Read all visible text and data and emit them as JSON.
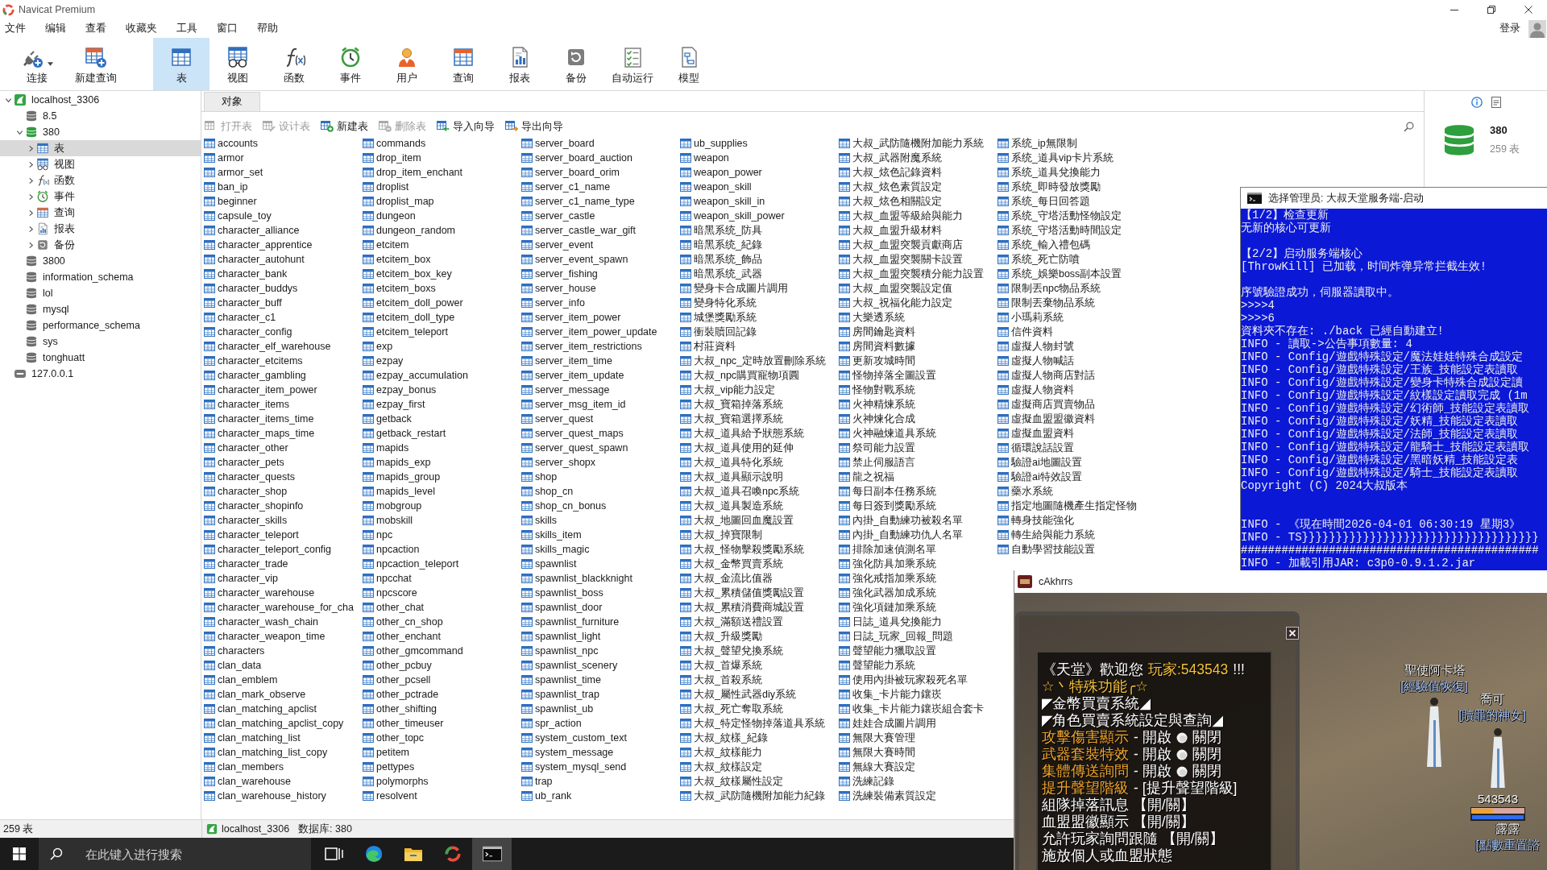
{
  "window": {
    "title": "Navicat Premium"
  },
  "menu_bar": {
    "items": [
      "文件",
      "编辑",
      "查看",
      "收藏夹",
      "工具",
      "窗口",
      "帮助"
    ],
    "login": "登录"
  },
  "toolbar": {
    "main": [
      {
        "label": "连接",
        "kind": "connection",
        "selected": false,
        "dropdown": true
      },
      {
        "label": "新建查询",
        "kind": "new_query",
        "selected": false,
        "dropdown": false
      }
    ],
    "objects": [
      {
        "label": "表",
        "kind": "table",
        "selected": true
      },
      {
        "label": "视图",
        "kind": "view",
        "selected": false
      },
      {
        "label": "函数",
        "kind": "function",
        "selected": false
      },
      {
        "label": "事件",
        "kind": "event",
        "selected": false
      },
      {
        "label": "用户",
        "kind": "user",
        "selected": false
      },
      {
        "label": "查询",
        "kind": "query",
        "selected": false
      },
      {
        "label": "报表",
        "kind": "report",
        "selected": false
      },
      {
        "label": "备份",
        "kind": "backup",
        "selected": false
      },
      {
        "label": "自动运行",
        "kind": "automation",
        "selected": false
      },
      {
        "label": "模型",
        "kind": "model",
        "selected": false
      }
    ]
  },
  "sidebar": {
    "tree": [
      {
        "label": "localhost_3306",
        "kind": "connection",
        "expanded": true,
        "selected": false,
        "children": [
          {
            "label": "8.5",
            "kind": "database",
            "expanded": false,
            "selected": false
          },
          {
            "label": "380",
            "kind": "database",
            "expanded": true,
            "selected": false,
            "children": [
              {
                "label": "表",
                "kind": "tables",
                "expanded": false,
                "selected": true
              },
              {
                "label": "视图",
                "kind": "views",
                "expanded": false,
                "selected": false
              },
              {
                "label": "函数",
                "kind": "functions",
                "expanded": false,
                "selected": false
              },
              {
                "label": "事件",
                "kind": "events",
                "expanded": false,
                "selected": false
              },
              {
                "label": "查询",
                "kind": "queries",
                "expanded": false,
                "selected": false
              },
              {
                "label": "报表",
                "kind": "reports",
                "expanded": false,
                "selected": false
              },
              {
                "label": "备份",
                "kind": "backups",
                "expanded": false,
                "selected": false
              }
            ]
          },
          {
            "label": "3800",
            "kind": "database",
            "expanded": false,
            "selected": false
          },
          {
            "label": "information_schema",
            "kind": "database",
            "expanded": false,
            "selected": false
          },
          {
            "label": "lol",
            "kind": "database",
            "expanded": false,
            "selected": false
          },
          {
            "label": "mysql",
            "kind": "database",
            "expanded": false,
            "selected": false
          },
          {
            "label": "performance_schema",
            "kind": "database",
            "expanded": false,
            "selected": false
          },
          {
            "label": "sys",
            "kind": "database",
            "expanded": false,
            "selected": false
          },
          {
            "label": "tonghuatt",
            "kind": "database",
            "expanded": false,
            "selected": false
          }
        ]
      },
      {
        "label": "127.0.0.1",
        "kind": "connection",
        "expanded": false,
        "selected": false
      }
    ]
  },
  "object_tabs": [
    {
      "label": "对象",
      "selected": true
    }
  ],
  "object_toolbar": [
    {
      "label": "打开表",
      "kind": "open",
      "disabled": true
    },
    {
      "label": "设计表",
      "kind": "design",
      "disabled": true
    },
    {
      "label": "新建表",
      "kind": "new",
      "disabled": false
    },
    {
      "label": "删除表",
      "kind": "delete",
      "disabled": true
    },
    {
      "label": "导入向导",
      "kind": "import",
      "disabled": false
    },
    {
      "label": "导出向导",
      "kind": "export",
      "disabled": false
    }
  ],
  "tables": [
    "accounts",
    "armor",
    "armor_set",
    "ban_ip",
    "beginner",
    "capsule_toy",
    "character_alliance",
    "character_apprentice",
    "character_autohunt",
    "character_bank",
    "character_buddys",
    "character_buff",
    "character_c1",
    "character_config",
    "character_elf_warehouse",
    "character_etcitems",
    "character_gambling",
    "character_item_power",
    "character_items",
    "character_items_time",
    "character_maps_time",
    "character_other",
    "character_pets",
    "character_quests",
    "character_shop",
    "character_shopinfo",
    "character_skills",
    "character_teleport",
    "character_teleport_config",
    "character_trade",
    "character_vip",
    "character_warehouse",
    "character_warehouse_for_cha",
    "character_wash_chain",
    "character_weapon_time",
    "characters",
    "clan_data",
    "clan_emblem",
    "clan_mark_observe",
    "clan_matching_apclist",
    "clan_matching_apclist_copy",
    "clan_matching_list",
    "clan_matching_list_copy",
    "clan_members",
    "clan_warehouse",
    "clan_warehouse_history",
    "commands",
    "drop_item",
    "drop_item_enchant",
    "droplist",
    "droplist_map",
    "dungeon",
    "dungeon_random",
    "etcitem",
    "etcitem_box",
    "etcitem_box_key",
    "etcitem_boxs",
    "etcitem_doll_power",
    "etcitem_doll_type",
    "etcitem_teleport",
    "exp",
    "ezpay",
    "ezpay_accumulation",
    "ezpay_bonus",
    "ezpay_first",
    "getback",
    "getback_restart",
    "mapids",
    "mapids_exp",
    "mapids_group",
    "mapids_level",
    "mobgroup",
    "mobskill",
    "npc",
    "npcaction",
    "npcaction_teleport",
    "npcchat",
    "npcscore",
    "other_chat",
    "other_cn_shop",
    "other_enchant",
    "other_gmcommand",
    "other_pcbuy",
    "other_pcsell",
    "other_pctrade",
    "other_shifting",
    "other_timeuser",
    "other_topc",
    "petitem",
    "pettypes",
    "polymorphs",
    "resolvent",
    "server_board",
    "server_board_auction",
    "server_board_orim",
    "server_c1_name",
    "server_c1_name_type",
    "server_castle",
    "server_castle_war_gift",
    "server_event",
    "server_event_spawn",
    "server_fishing",
    "server_house",
    "server_info",
    "server_item_power",
    "server_item_power_update",
    "server_item_restrictions",
    "server_item_time",
    "server_item_update",
    "server_message",
    "server_msg_item_id",
    "server_quest",
    "server_quest_maps",
    "server_quest_spawn",
    "server_shopx",
    "shop",
    "shop_cn",
    "shop_cn_bonus",
    "skills",
    "skills_item",
    "skills_magic",
    "spawnlist",
    "spawnlist_blackknight",
    "spawnlist_boss",
    "spawnlist_door",
    "spawnlist_furniture",
    "spawnlist_light",
    "spawnlist_npc",
    "spawnlist_scenery",
    "spawnlist_time",
    "spawnlist_trap",
    "spawnlist_ub",
    "spr_action",
    "system_custom_text",
    "system_message",
    "system_mysql_send",
    "trap",
    "ub_rank",
    "ub_supplies",
    "weapon",
    "weapon_power",
    "weapon_skill",
    "weapon_skill_in",
    "weapon_skill_power",
    "暗黑系统_防具",
    "暗黑系统_紀錄",
    "暗黑系统_飾品",
    "暗黑系统_武器",
    "變身卡合成圖片調用",
    "變身特化系統",
    "城堡獎勵系統",
    "衝裝贖回記錄",
    "村莊資料",
    "大叔_npc_定時放置刪除系統",
    "大叔_npc購買寵物項圓",
    "大叔_vip能力設定",
    "大叔_寶箱掉落系統",
    "大叔_寶箱選擇系統",
    "大叔_道具給予狀態系統",
    "大叔_道具使用的延伸",
    "大叔_道具特化系統",
    "大叔_道具顯示說明",
    "大叔_道具召喚npc系統",
    "大叔_道具製造系統",
    "大叔_地圖回血魔設置",
    "大叔_掉寶限制",
    "大叔_怪物擊殺獎勵系統",
    "大叔_金幣買賣系統",
    "大叔_金流比值器",
    "大叔_累積儲值獎勵設置",
    "大叔_累積消費商城設置",
    "大叔_滿額送禮設置",
    "大叔_升級獎勵",
    "大叔_聲望兌換系統",
    "大叔_首爆系統",
    "大叔_首殺系統",
    "大叔_屬性武器diy系統",
    "大叔_死亡奪取系統",
    "大叔_特定怪物掉落道具系統",
    "大叔_紋樣_紀錄",
    "大叔_紋樣能力",
    "大叔_紋樣設定",
    "大叔_紋樣屬性設定",
    "大叔_武防隨機附加能力紀錄",
    "大叔_武防隨機附加能力系統",
    "大叔_武器附魔系統",
    "大叔_炫色記錄資料",
    "大叔_炫色素質設定",
    "大叔_炫色相關設定",
    "大叔_血盟等級給與能力",
    "大叔_血盟升級材料",
    "大叔_血盟突襲貢獻商店",
    "大叔_血盟突襲關卡設置",
    "大叔_血盟突襲積分能力設置",
    "大叔_血盟突襲設定值",
    "大叔_祝福化能力設定",
    "大樂透系統",
    "房間鑰匙資料",
    "房間資料數據",
    "更新攻城時間",
    "怪物掉落全圖設置",
    "怪物對戰系統",
    "火神精煉系統",
    "火神煉化合成",
    "火神融煉道具系統",
    "祭司能力設置",
    "禁止伺服語言",
    "龍之祝福",
    "每日副本任務系統",
    "每日簽到獎勵系統",
    "內掛_自動練功被殺名單",
    "內掛_自動練功仇人名單",
    "排除加速偵測名單",
    "強化防具加乘系統",
    "強化戒指加乘系統",
    "強化武器加成系統",
    "強化項鏈加乘系統",
    "日誌_道具兌換能力",
    "日誌_玩家_回報_問題",
    "聲望能力獵取設置",
    "聲望能力系統",
    "使用內掛被玩家殺死名單",
    "收集_卡片能力鑲崁",
    "收集_卡片能力鑲崁組合套卡",
    "娃娃合成圖片調用",
    "無限大賽管理",
    "無限大賽時間",
    "無線大賽設定",
    "洗練記錄",
    "洗練裝備素質設定",
    "系统_ip無限制",
    "系统_道具vip卡片系統",
    "系统_道具兌換能力",
    "系统_即時發放獎勵",
    "系统_每日回答題",
    "系统_守塔活動怪物設定",
    "系统_守塔活動時間設定",
    "系统_輸入禮包碼",
    "系统_死亡防噴",
    "系统_娛樂boss副本設置",
    "限制丟npc物品系統",
    "限制丟棄物品系統",
    "小瑪莉系統",
    "信件資料",
    "虛擬人物封號",
    "虛擬人物喊話",
    "虛擬人物商店對話",
    "虛擬人物資料",
    "虛擬商店買賣物品",
    "虛擬血盟盟徽資料",
    "虛擬血盟資料",
    "循環說話設置",
    "驗證ai地圖設置",
    "驗證ai特效設置",
    "藥水系統",
    "指定地圖隨機產生指定怪物",
    "轉身技能強化",
    "轉生給與能力系統",
    "自動學習技能設置"
  ],
  "info_pane": {
    "name": "380",
    "count": "259 表"
  },
  "status_bar": {
    "count": "259 表",
    "connection": "localhost_3306",
    "database": "数据库: 380"
  },
  "taskbar": {
    "search": {
      "placeholder": "在此键入进行搜索"
    },
    "apps": [
      {
        "kind": "task_view",
        "active": false
      },
      {
        "kind": "browser",
        "active": false
      },
      {
        "kind": "files",
        "active": false
      },
      {
        "kind": "database_app",
        "active": false
      },
      {
        "kind": "terminal",
        "active": true
      }
    ]
  },
  "console_window": {
    "title": "选择管理员: 大叔天堂服务端-启动",
    "lines": [
      {
        "kind": "line",
        "text": "【1/2】检查更新"
      },
      {
        "kind": "line",
        "text": "无新的核心可更新"
      },
      {
        "kind": "blank"
      },
      {
        "kind": "line",
        "text": "【2/2】启动服务端核心"
      },
      {
        "kind": "line",
        "text": "[ThrowKill] 已加载，时间炸弹异常拦截生效!"
      },
      {
        "kind": "blank"
      },
      {
        "kind": "line",
        "text": "序號驗證成功，伺服器讀取中。"
      },
      {
        "kind": "line",
        "text": ">>>>4"
      },
      {
        "kind": "line",
        "text": ">>>>6"
      },
      {
        "kind": "line",
        "text": "資料夾不存在: ./back 已經自動建立!"
      },
      {
        "kind": "line",
        "text": "INFO - 讀取->公告事項數量: 4"
      },
      {
        "kind": "line",
        "text": "INFO - Config/遊戲特殊設定/魔法娃娃特殊合成設定"
      },
      {
        "kind": "line",
        "text": "INFO - Config/遊戲特殊設定/王族_技能設定表讀取"
      },
      {
        "kind": "line",
        "text": "INFO - Config/遊戲特殊設定/變身卡特殊合成設定讀"
      },
      {
        "kind": "line",
        "text": "INFO - Config/遊戲特殊設定/紋樣設定讀取完成 (1m"
      },
      {
        "kind": "line",
        "text": "INFO - Config/遊戲特殊設定/幻術師_技能設定表讀取"
      },
      {
        "kind": "line",
        "text": "INFO - Config/遊戲特殊設定/妖精_技能設定表讀取"
      },
      {
        "kind": "line",
        "text": "INFO - Config/遊戲特殊設定/法師_技能設定表讀取"
      },
      {
        "kind": "line",
        "text": "INFO - Config/遊戲特殊設定/龍騎士_技能設定表讀取"
      },
      {
        "kind": "line",
        "text": "INFO - Config/遊戲特殊設定/黑暗妖精_技能設定表"
      },
      {
        "kind": "line",
        "text": "INFO - Config/遊戲特殊設定/騎士_技能設定表讀取"
      },
      {
        "kind": "line",
        "text": "Copyright (C) 2024大叔版本"
      },
      {
        "kind": "blank"
      },
      {
        "kind": "blank"
      },
      {
        "kind": "line",
        "text": "INFO - 《現在時間2026-04-01 06:30:19 星期3》"
      },
      {
        "kind": "line",
        "text": "INFO - TS}}}}}}}}}}}}}}}}}}}}}}}}}}}}}}}}}}}"
      },
      {
        "kind": "line",
        "text": "############################################"
      },
      {
        "kind": "line",
        "text": "INFO - 加載引用JAR: c3p0-0.9.1.2.jar"
      }
    ]
  },
  "game_window": {
    "title": "cAkhrrs",
    "dialog": {
      "lines": [
        {
          "parts": [
            {
              "kind": "text",
              "text": "《天堂》歡迎您",
              "color": "#ffffff"
            },
            {
              "kind": "text",
              "text": "玩家:543543",
              "color": "#f3c13a"
            },
            {
              "kind": "text",
              "text": "!!!",
              "color": "#ffffff"
            }
          ]
        },
        {
          "parts": [
            {
              "kind": "text",
              "text": "☆丶特殊功能╭☆",
              "color": "#f3c13a"
            }
          ]
        },
        {
          "parts": [
            {
              "kind": "text",
              "text": "◤金幣買賣系統◢",
              "color": "#ffffff"
            }
          ]
        },
        {
          "parts": [
            {
              "kind": "text",
              "text": "◤角色買賣系統設定與查詢◢",
              "color": "#ffffff"
            }
          ]
        },
        {
          "parts": [
            {
              "kind": "text",
              "text": "攻擊傷害顯示",
              "color": "#f0a52c"
            },
            {
              "kind": "text",
              "text": "- 開啟",
              "color": "#ffffff"
            },
            {
              "kind": "dot"
            },
            {
              "kind": "text",
              "text": "關閉",
              "color": "#ffffff"
            }
          ]
        },
        {
          "parts": [
            {
              "kind": "text",
              "text": "武器套裝特效",
              "color": "#f0a52c"
            },
            {
              "kind": "text",
              "text": "- 開啟",
              "color": "#ffffff"
            },
            {
              "kind": "dot"
            },
            {
              "kind": "text",
              "text": "關閉",
              "color": "#ffffff"
            }
          ]
        },
        {
          "parts": [
            {
              "kind": "text",
              "text": "集體傳送詢問",
              "color": "#f0a52c"
            },
            {
              "kind": "text",
              "text": "- 開啟",
              "color": "#ffffff"
            },
            {
              "kind": "dot"
            },
            {
              "kind": "text",
              "text": "關閉",
              "color": "#ffffff"
            }
          ]
        },
        {
          "parts": [
            {
              "kind": "text",
              "text": "提升聲望階級",
              "color": "#f0a52c"
            },
            {
              "kind": "text",
              "text": "- [提升聲望階級]",
              "color": "#ffffff"
            }
          ]
        },
        {
          "parts": [
            {
              "kind": "text",
              "text": "組隊掉落訊息 【開/關】",
              "color": "#ffffff"
            }
          ]
        },
        {
          "parts": [
            {
              "kind": "text",
              "text": "血盟盟徽顯示 【開/關】",
              "color": "#ffffff"
            }
          ]
        },
        {
          "parts": [
            {
              "kind": "text",
              "text": "允許玩家詢問跟隨 【開/關】",
              "color": "#ffffff"
            }
          ]
        },
        {
          "parts": [
            {
              "kind": "text",
              "text": "施放個人或血盟狀態",
              "color": "#ffffff"
            }
          ]
        }
      ]
    },
    "npcs": [
      {
        "name": "聖使阿卡塔",
        "title": "[經驗值恢復]"
      },
      {
        "name": "喬可",
        "title": "[贖罪的神女]"
      },
      {
        "name": "露露",
        "title": "[點數重置諮"
      }
    ],
    "player": {
      "name": "543543",
      "hp": {
        "level": 0.4
      },
      "mp": {
        "level": 1
      }
    }
  }
}
